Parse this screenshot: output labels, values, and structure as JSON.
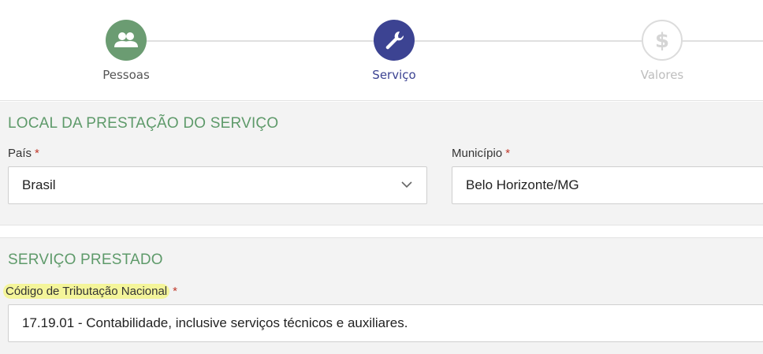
{
  "stepper": {
    "steps": [
      {
        "label": "Pessoas",
        "icon": "users-icon",
        "state": "done"
      },
      {
        "label": "Serviço",
        "icon": "wrench-icon",
        "state": "active"
      },
      {
        "label": "Valores",
        "icon": "dollar-icon",
        "state": "pending"
      }
    ]
  },
  "local": {
    "title": "LOCAL DA PRESTAÇÃO DO SERVIÇO",
    "pais": {
      "label": "País",
      "required_mark": "*",
      "value": "Brasil"
    },
    "municipio": {
      "label": "Município",
      "required_mark": "*",
      "value": "Belo Horizonte/MG"
    }
  },
  "servico": {
    "title": "SERVIÇO PRESTADO",
    "codigo": {
      "label": "Código de Tributação Nacional",
      "required_mark": "*",
      "value": "17.19.01 - Contabilidade, inclusive serviços técnicos e auxiliares."
    }
  },
  "colors": {
    "done": "#6b9c72",
    "active": "#3c4392",
    "section_title": "#5e9a6a",
    "required": "#c0392b",
    "highlight": "#f4f59a"
  }
}
